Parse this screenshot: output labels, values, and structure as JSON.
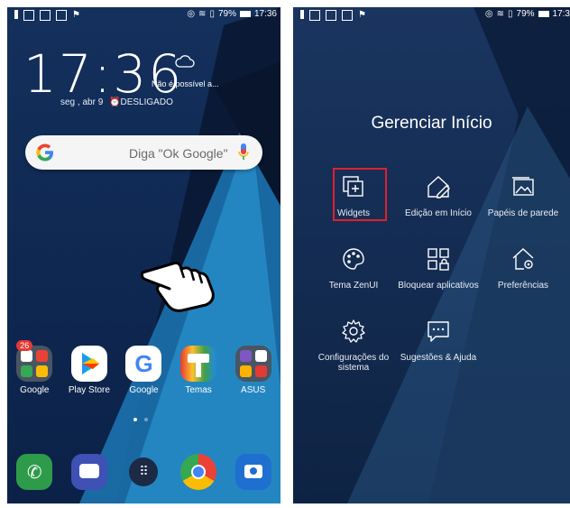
{
  "left_screen": {
    "status": {
      "battery": "79%",
      "time": "17:36"
    },
    "clock": "17:36",
    "date": "seg , abr 9",
    "alarm": "DESLIGADO",
    "weather_text": "Não é possível a...",
    "search": {
      "hint": "Diga \"Ok Google\""
    },
    "apps": [
      {
        "label": "Google",
        "icon": "google-folder-icon",
        "badge": "26"
      },
      {
        "label": "Play Store",
        "icon": "play-store-icon"
      },
      {
        "label": "Google",
        "icon": "google-icon"
      },
      {
        "label": "Temas",
        "icon": "themes-icon"
      },
      {
        "label": "ASUS",
        "icon": "asus-folder-icon"
      }
    ],
    "dock": [
      {
        "icon": "phone-icon"
      },
      {
        "icon": "messages-icon"
      },
      {
        "icon": "app-drawer-icon"
      },
      {
        "icon": "chrome-icon"
      },
      {
        "icon": "camera-icon"
      }
    ]
  },
  "right_screen": {
    "status": {
      "battery": "79%",
      "time": "17:3"
    },
    "title": "Gerenciar Início",
    "options": [
      {
        "label": "Widgets",
        "icon": "widgets-icon"
      },
      {
        "label": "Edição em Início",
        "icon": "home-edit-icon"
      },
      {
        "label": "Papéis de parede",
        "icon": "wallpaper-icon"
      },
      {
        "label": "Tema ZenUI",
        "icon": "theme-palette-icon"
      },
      {
        "label": "Bloquear aplicativos",
        "icon": "app-lock-icon"
      },
      {
        "label": "Preferências",
        "icon": "home-settings-icon"
      },
      {
        "label": "Configurações do sistema",
        "icon": "gear-icon"
      },
      {
        "label": "Sugestões & Ajuda",
        "icon": "feedback-icon"
      }
    ]
  },
  "colors": {
    "highlight": "#e2202a"
  }
}
